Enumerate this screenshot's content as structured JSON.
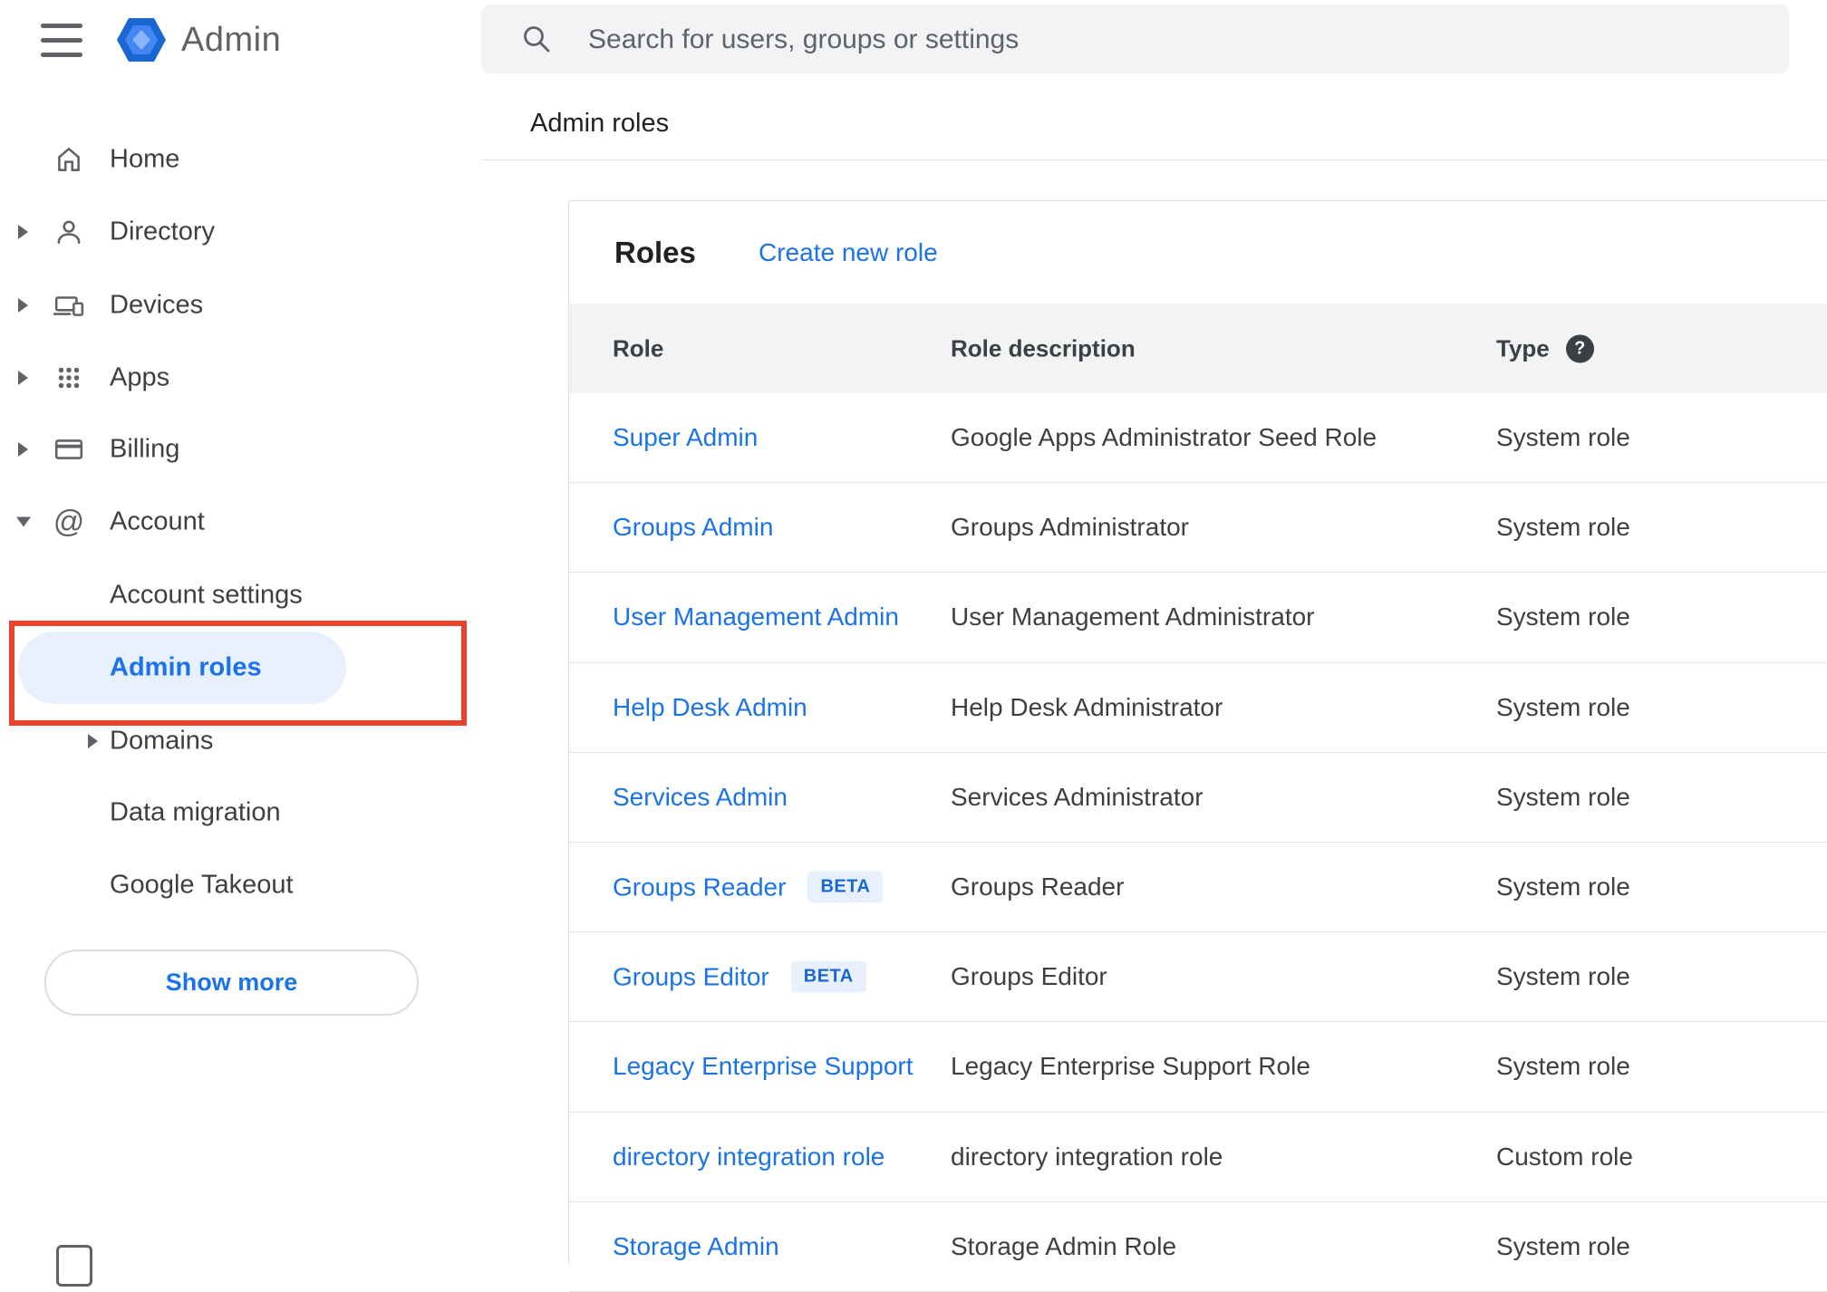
{
  "colors": {
    "link_blue": "#1a73e8",
    "selected_bg": "#e8f0fe",
    "annotation_red": "#e8432c",
    "header_gray": "#f1f3f4",
    "beta_blue": "#1967d2"
  },
  "sidebar": {
    "brand": "Admin",
    "items": [
      {
        "label": "Home"
      },
      {
        "label": "Directory"
      },
      {
        "label": "Devices"
      },
      {
        "label": "Apps"
      },
      {
        "label": "Billing"
      },
      {
        "label": "Account"
      }
    ],
    "account_children": [
      {
        "label": "Account settings"
      },
      {
        "label": "Admin roles",
        "selected": true
      },
      {
        "label": "Domains"
      },
      {
        "label": "Data migration"
      },
      {
        "label": "Google Takeout"
      }
    ],
    "show_more_label": "Show more"
  },
  "search": {
    "placeholder": "Search for users, groups or settings"
  },
  "page": {
    "breadcrumb": "Admin roles"
  },
  "roles_card": {
    "title": "Roles",
    "create_link": "Create new role",
    "columns": {
      "role": "Role",
      "description": "Role description",
      "type": "Type"
    },
    "beta_label": "BETA",
    "help_glyph": "?",
    "rows": [
      {
        "role": "Super Admin",
        "beta": false,
        "description": "Google Apps Administrator Seed Role",
        "type": "System role"
      },
      {
        "role": "Groups Admin",
        "beta": false,
        "description": "Groups Administrator",
        "type": "System role"
      },
      {
        "role": "User Management Admin",
        "beta": false,
        "description": "User Management Administrator",
        "type": "System role"
      },
      {
        "role": "Help Desk Admin",
        "beta": false,
        "description": "Help Desk Administrator",
        "type": "System role"
      },
      {
        "role": "Services Admin",
        "beta": false,
        "description": "Services Administrator",
        "type": "System role"
      },
      {
        "role": "Groups Reader",
        "beta": true,
        "description": "Groups Reader",
        "type": "System role"
      },
      {
        "role": "Groups Editor",
        "beta": true,
        "description": "Groups Editor",
        "type": "System role"
      },
      {
        "role": "Legacy Enterprise Support",
        "beta": false,
        "description": "Legacy Enterprise Support Role",
        "type": "System role"
      },
      {
        "role": "directory integration role",
        "beta": false,
        "description": "directory integration role",
        "type": "Custom role"
      },
      {
        "role": "Storage Admin",
        "beta": false,
        "description": "Storage Admin Role",
        "type": "System role"
      }
    ]
  }
}
